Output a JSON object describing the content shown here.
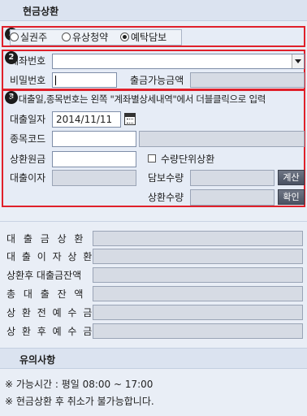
{
  "header": {
    "title": "현금상환"
  },
  "section1": {
    "badge": "1",
    "radios": [
      {
        "label": "실권주",
        "selected": false
      },
      {
        "label": "유상청약",
        "selected": false
      },
      {
        "label": "예탁담보",
        "selected": true
      }
    ]
  },
  "section2": {
    "badge": "2",
    "account_label": "계좌번호",
    "account_value": "",
    "password_label": "비밀번호",
    "available_label": "출금가능금액"
  },
  "section3": {
    "badge": "3",
    "notice": "※ 대출일,종목번호는 왼쪽 \"계좌별상세내역\"에서 더블클릭으로 입력",
    "loan_date_label": "대출일자",
    "loan_date_value": "2014/11/11",
    "stock_code_label": "종목코드",
    "principal_label": "상환원금",
    "qty_repay_label": "수량단위상환",
    "interest_label": "대출이자",
    "collateral_qty_label": "담보수량",
    "calc_button": "계산",
    "repay_qty_label": "상환수량",
    "confirm_button": "확인"
  },
  "summary": {
    "rows": [
      "대 출 금 상 환",
      "대 출 이 자 상 환",
      "상환후 대출금잔액",
      "총 대 출 잔 액",
      "상 환 전 예 수 금",
      "상 환 후 예 수 금"
    ]
  },
  "notes": {
    "title": "유의사항",
    "lines": [
      "※ 가능시간 : 평일 08:00 ~ 17:00",
      "※ 현금상환 후 취소가 불가능합니다."
    ]
  }
}
